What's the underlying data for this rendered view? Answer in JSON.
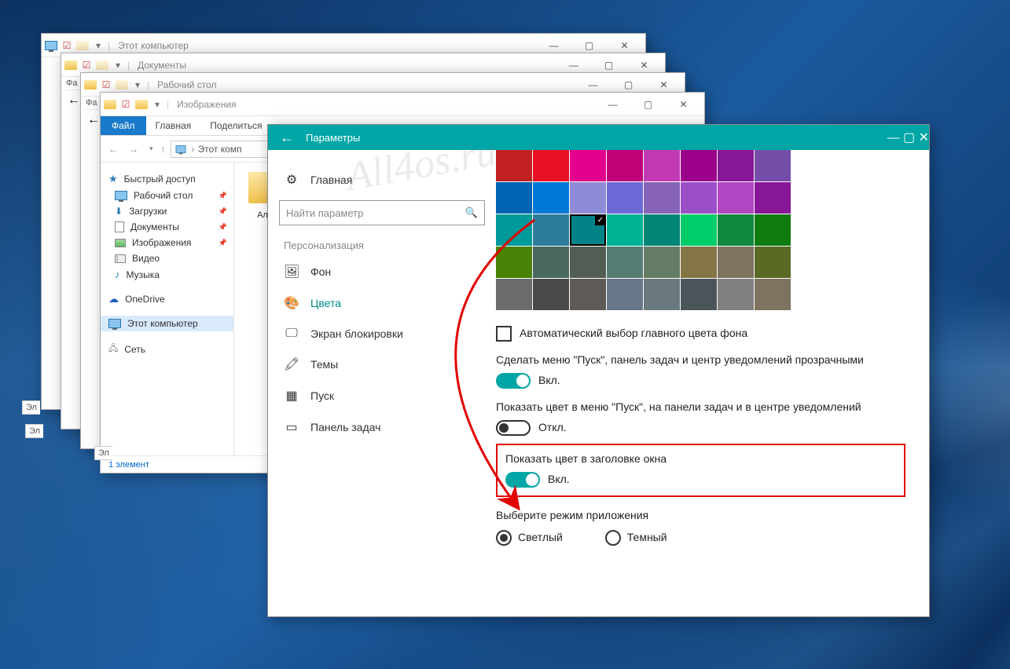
{
  "watermark": "All4os.ru",
  "explorer": {
    "windows": [
      {
        "title": "Этот компьютер"
      },
      {
        "title": "Документы"
      },
      {
        "title": "Рабочий стол"
      },
      {
        "title": "Изображения"
      }
    ],
    "ribbon": {
      "file": "Файл",
      "home": "Главная",
      "share": "Поделиться"
    },
    "breadcrumb_prefix": "Этот комп",
    "status": "1 элемент",
    "folder_label": "Альб",
    "sidebar": {
      "quick_access": "Быстрый доступ",
      "items": [
        {
          "label": "Рабочий стол",
          "icon": "desktop"
        },
        {
          "label": "Загрузки",
          "icon": "download"
        },
        {
          "label": "Документы",
          "icon": "document"
        },
        {
          "label": "Изображения",
          "icon": "picture"
        },
        {
          "label": "Видео",
          "icon": "video"
        },
        {
          "label": "Музыка",
          "icon": "music"
        }
      ],
      "onedrive": "OneDrive",
      "this_pc": "Этот компьютер",
      "network": "Сеть"
    },
    "truncated_sidebar_labels": [
      "Эл",
      "Эл",
      "Эл"
    ]
  },
  "settings": {
    "title": "Параметры",
    "nav": {
      "home": "Главная",
      "search_placeholder": "Найти параметр",
      "section": "Персонализация",
      "items": [
        {
          "label": "Фон",
          "icon": "picture-icon"
        },
        {
          "label": "Цвета",
          "icon": "palette-icon",
          "active": true
        },
        {
          "label": "Экран блокировки",
          "icon": "lockscreen-icon"
        },
        {
          "label": "Темы",
          "icon": "themes-icon"
        },
        {
          "label": "Пуск",
          "icon": "start-icon"
        },
        {
          "label": "Панель задач",
          "icon": "taskbar-icon"
        }
      ]
    },
    "colors": {
      "palette": [
        [
          "#c02020",
          "#e81123",
          "#e3008c",
          "#bf0077",
          "#c239b3",
          "#9a0089",
          "#881798",
          "#744da9"
        ],
        [
          "#0063b1",
          "#0078d7",
          "#8e8cd8",
          "#6b69d6",
          "#8764b8",
          "#9a4fc7",
          "#b146c2",
          "#881798"
        ],
        [
          "#009999",
          "#2d7d9a",
          "#038387",
          "#00b294",
          "#018574",
          "#00cc6a",
          "#10893e",
          "#107c10"
        ],
        [
          "#498205",
          "#486860",
          "#525e54",
          "#567c73",
          "#647c64",
          "#847545",
          "#7e735f",
          "#5a6a24"
        ],
        [
          "#6b6b6b",
          "#4c4a48",
          "#5d5a58",
          "#68768a",
          "#69797e",
          "#4a5459",
          "#808080",
          "#7e735f"
        ]
      ],
      "selected_row": 2,
      "selected_col": 2,
      "auto_checkbox_label": "Автоматический выбор главного цвета фона",
      "opt_transparent": {
        "label": "Сделать меню \"Пуск\", панель задач и центр уведомлений прозрачными",
        "state": "Вкл.",
        "on": true
      },
      "opt_show_color": {
        "label": "Показать цвет в меню \"Пуск\", на панели задач и в центре уведомлений",
        "state": "Откл.",
        "on": false
      },
      "opt_title_color": {
        "label": "Показать цвет в заголовке окна",
        "state": "Вкл.",
        "on": true
      },
      "app_mode_label": "Выберите режим приложения",
      "app_mode_light": "Светлый",
      "app_mode_dark": "Темный"
    }
  }
}
